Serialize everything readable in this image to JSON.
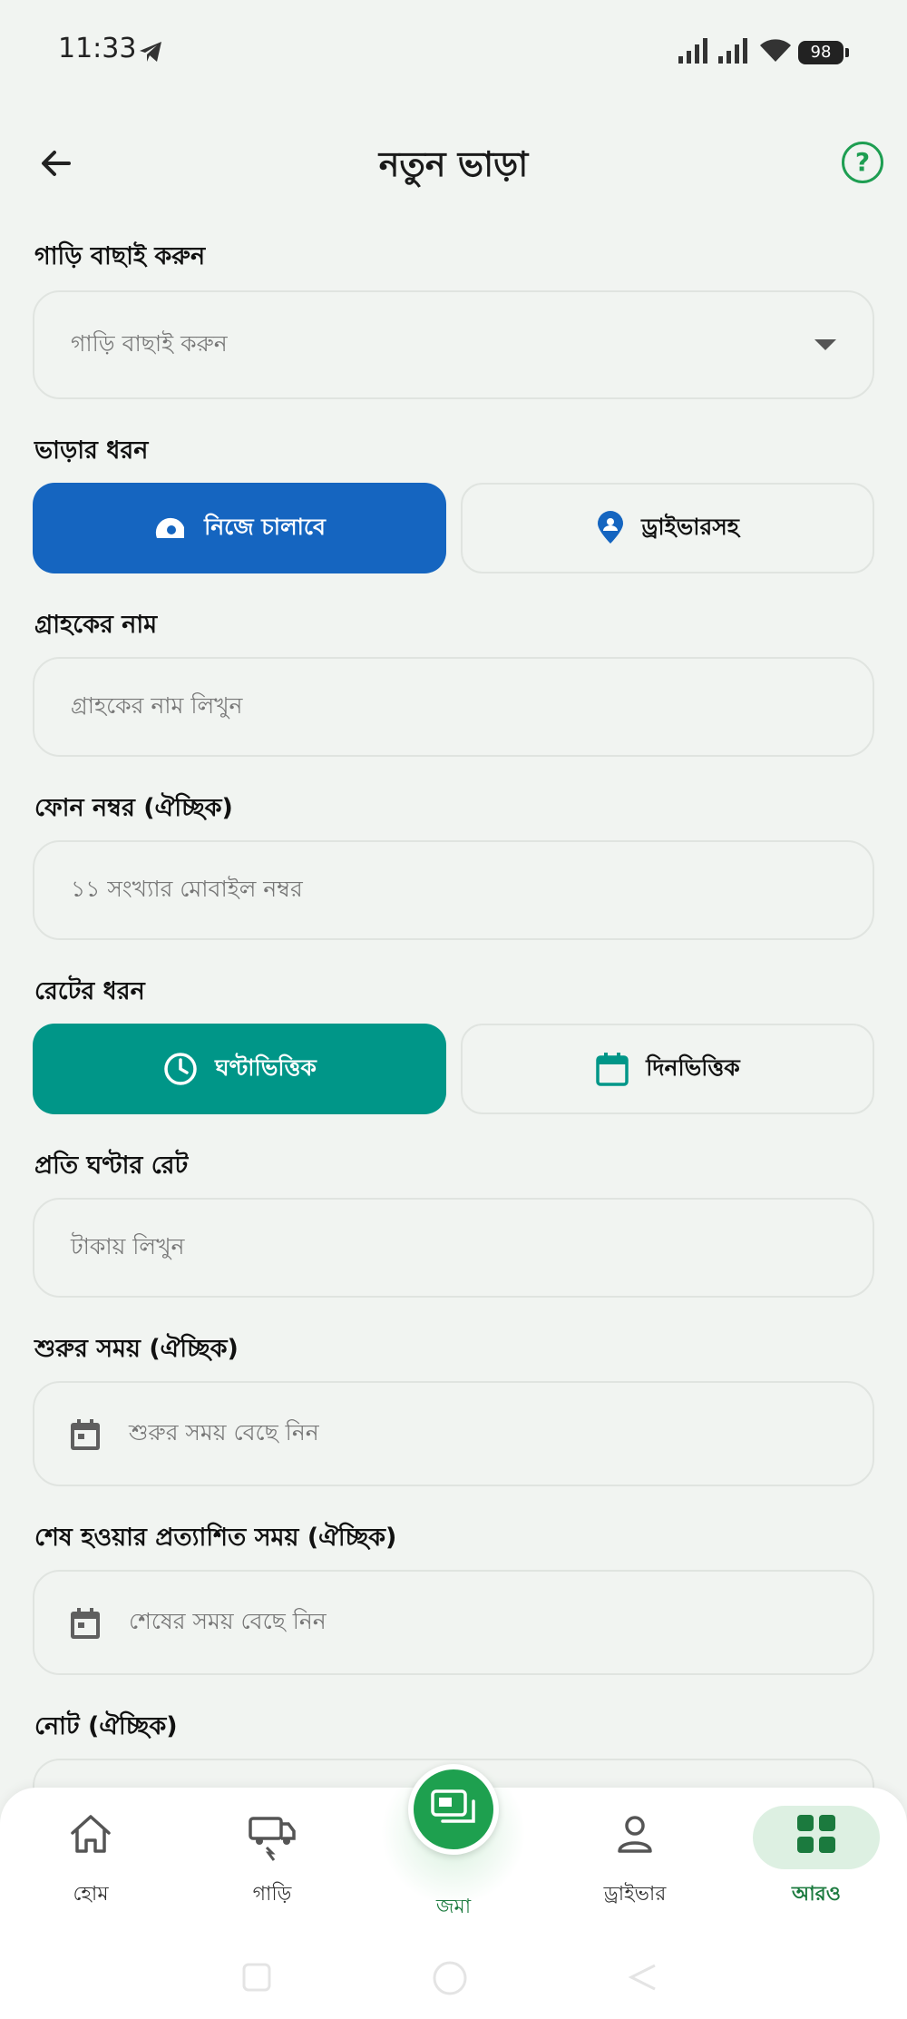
{
  "status": {
    "time": "11:33",
    "battery": "98"
  },
  "header": {
    "title": "নতুন ভাড়া",
    "help": "?"
  },
  "vehicle": {
    "label": "গাড়ি বাছাই করুন",
    "placeholder": "গাড়ি বাছাই করুন"
  },
  "rental_type": {
    "label": "ভাড়ার ধরন",
    "options": [
      "নিজে চালাবে",
      "ড্রাইভারসহ"
    ],
    "selected": 0
  },
  "customer": {
    "label": "গ্রাহকের নাম",
    "placeholder": "গ্রাহকের নাম লিখুন"
  },
  "phone": {
    "label": "ফোন নম্বর (ঐচ্ছিক)",
    "placeholder": "১১ সংখ্যার মোবাইল নম্বর"
  },
  "rate_type": {
    "label": "রেটের ধরন",
    "options": [
      "ঘণ্টাভিত্তিক",
      "দিনভিত্তিক"
    ],
    "selected": 0
  },
  "rate": {
    "label": "প্রতি ঘণ্টার রেট",
    "placeholder": "টাকায় লিখুন"
  },
  "start_time": {
    "label": "শুরুর সময় (ঐচ্ছিক)",
    "placeholder": "শুরুর সময় বেছে নিন"
  },
  "end_time": {
    "label": "শেষ হওয়ার প্রত্যাশিত সময় (ঐচ্ছিক)",
    "placeholder": "শেষের সময় বেছে নিন"
  },
  "note": {
    "label": "নোট (ঐচ্ছিক)"
  },
  "nav": {
    "items": [
      "হোম",
      "গাড়ি",
      "জমা",
      "ড্রাইভার",
      "আরও"
    ],
    "active": "আরও"
  },
  "colors": {
    "primary_green": "#1ea04f",
    "blue": "#1565c0",
    "teal": "#009688",
    "background": "#f1f4f1"
  }
}
